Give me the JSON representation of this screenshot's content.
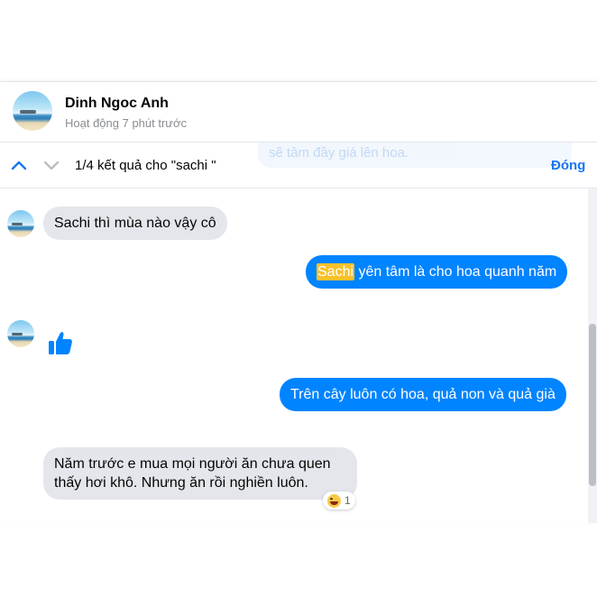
{
  "conversation": {
    "contact_name": "Dinh Ngoc Anh",
    "contact_status": "Hoạt động 7 phút trước"
  },
  "search": {
    "result_text": "1/4 kết quả cho \"sachi \"",
    "close_label": "Đóng",
    "ghost_text": "sẽ tâm đầy giá lên hoa."
  },
  "messages": [
    {
      "side": "in",
      "text": "Sachi thì mùa nào vậy cô"
    },
    {
      "side": "out",
      "highlight": "Sachi",
      "text": " yên tâm là cho hoa quanh năm"
    },
    {
      "side": "in",
      "type": "like",
      "icon": "thumbs-up-icon"
    },
    {
      "side": "out",
      "text": "Trên cây luôn có hoa, quả non và quả già"
    },
    {
      "side": "in",
      "line1": "Năm trước e mua mọi người ăn chưa quen",
      "line2": "thấy hơi khô. Nhưng ăn rồi nghiền luôn.",
      "reaction": {
        "emoji": "laughing-face-icon",
        "count": "1"
      }
    }
  ],
  "colors": {
    "accent": "#1877f2",
    "outgoing_bubble": "#0084ff",
    "incoming_bubble": "#e4e6eb",
    "highlight": "#f7c12b"
  }
}
